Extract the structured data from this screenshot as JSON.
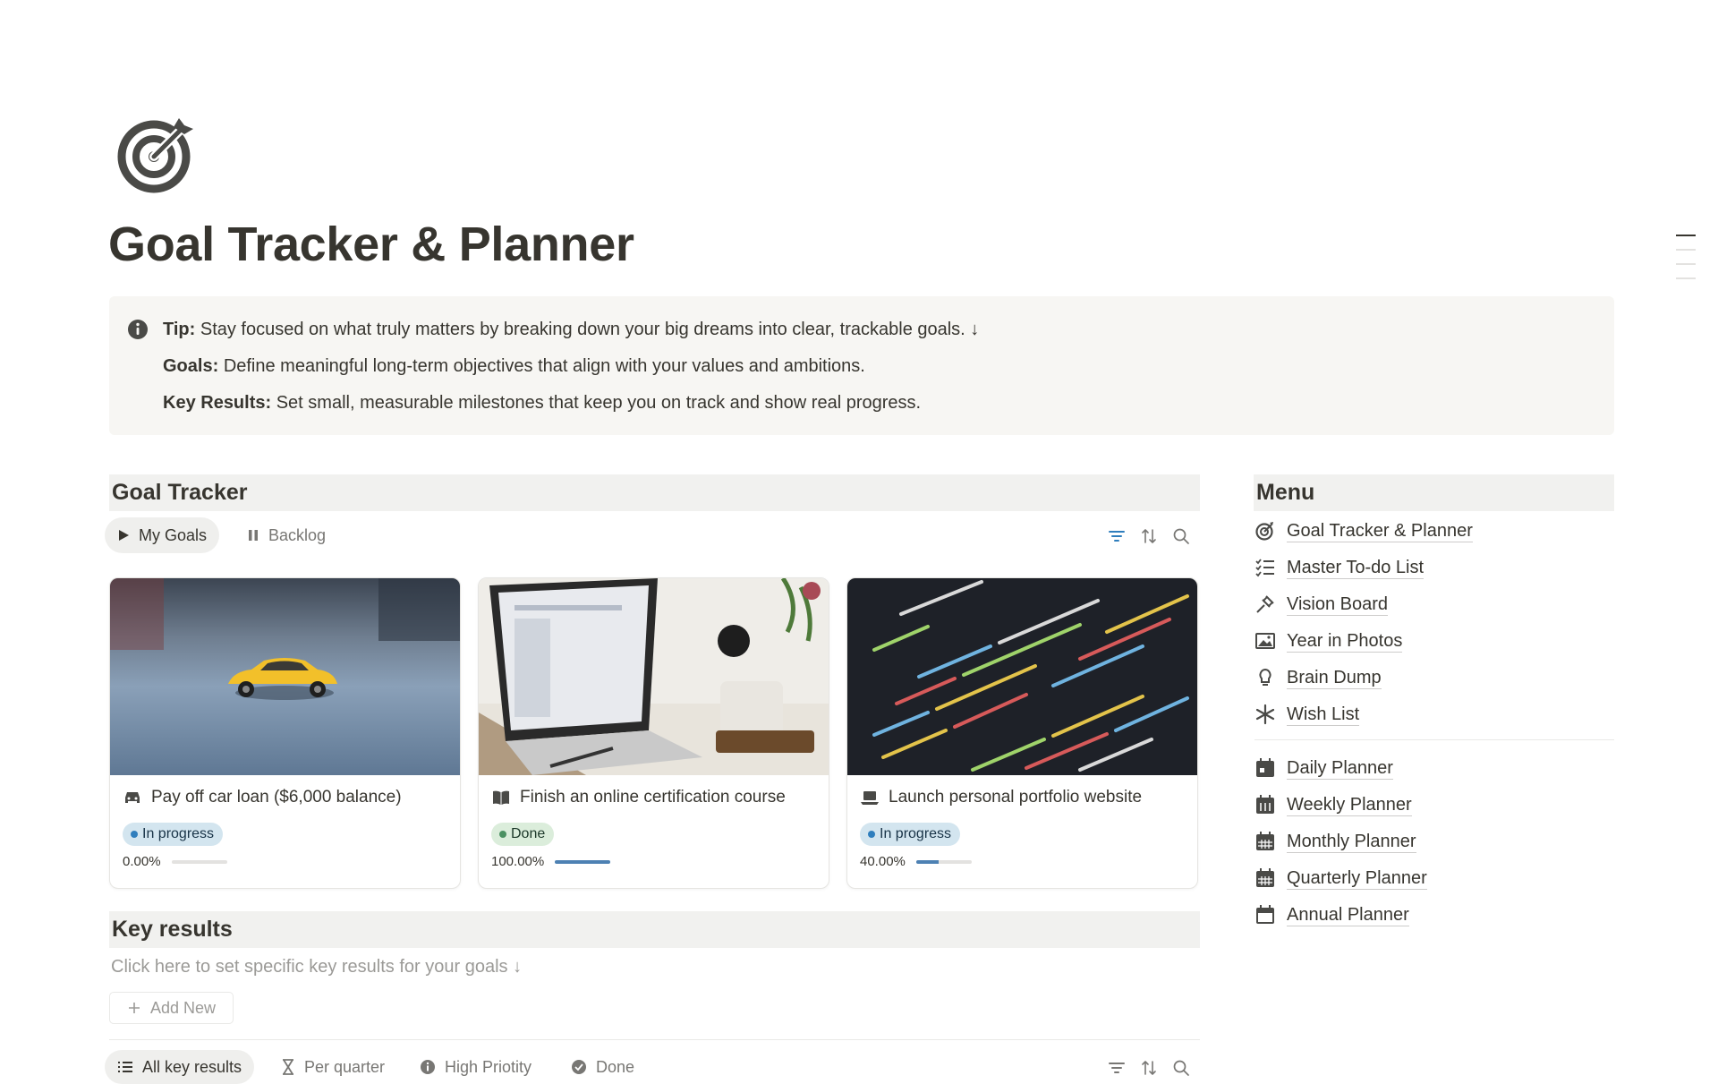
{
  "page": {
    "title": "Goal Tracker & Planner",
    "icon": "target-icon"
  },
  "callout": {
    "icon": "info-icon",
    "lines": [
      {
        "label": "Tip:",
        "text": "Stay focused on what truly matters by breaking down your big dreams into clear, trackable goals. ↓"
      },
      {
        "label": "Goals:",
        "text": "Define meaningful long-term objectives that align with your values and ambitions."
      },
      {
        "label": "Key Results:",
        "text": "Set small, measurable milestones that keep you on track and show real progress."
      }
    ]
  },
  "goal_tracker": {
    "heading": "Goal Tracker",
    "tabs": [
      {
        "label": "My Goals",
        "icon": "play-icon",
        "active": true
      },
      {
        "label": "Backlog",
        "icon": "pause-icon",
        "active": false
      }
    ],
    "tools": [
      "filter-icon",
      "sort-icon",
      "search-icon"
    ],
    "cards": [
      {
        "icon": "car-icon",
        "title": "Pay off car loan ($6,000 balance)",
        "status": "In progress",
        "progress_text": "0.00%",
        "progress": 0.0
      },
      {
        "icon": "book-icon",
        "title": "Finish an online certification course",
        "status": "Done",
        "progress_text": "100.00%",
        "progress": 1.0
      },
      {
        "icon": "laptop-icon",
        "title": "Launch personal portfolio website",
        "status": "In progress",
        "progress_text": "40.00%",
        "progress": 0.4
      }
    ]
  },
  "menu": {
    "heading": "Menu",
    "items": [
      {
        "label": "Goal Tracker & Planner",
        "icon": "target-icon"
      },
      {
        "label": "Master To-do List",
        "icon": "checklist-icon"
      },
      {
        "label": "Vision Board",
        "icon": "pin-icon"
      },
      {
        "label": "Year in Photos",
        "icon": "image-icon"
      },
      {
        "label": "Brain Dump",
        "icon": "lightbulb-icon"
      },
      {
        "label": "Wish List",
        "icon": "asterisk-icon"
      },
      {
        "label": "Daily Planner",
        "icon": "calendar-day-icon"
      },
      {
        "label": "Weekly Planner",
        "icon": "calendar-week-icon"
      },
      {
        "label": "Monthly Planner",
        "icon": "calendar-month-icon"
      },
      {
        "label": "Quarterly Planner",
        "icon": "calendar-quarter-icon"
      },
      {
        "label": "Annual Planner",
        "icon": "calendar-icon"
      }
    ]
  },
  "key_results": {
    "heading": "Key results",
    "hint": "Click here to set specific key results for your goals ↓",
    "add_new": "Add New",
    "tabs": [
      {
        "label": "All key results",
        "icon": "list-icon",
        "active": true
      },
      {
        "label": "Per quarter",
        "icon": "hourglass-icon",
        "active": false
      },
      {
        "label": "High Priotity",
        "icon": "info-icon",
        "active": false
      },
      {
        "label": "Done",
        "icon": "check-circle-icon",
        "active": false
      }
    ]
  }
}
